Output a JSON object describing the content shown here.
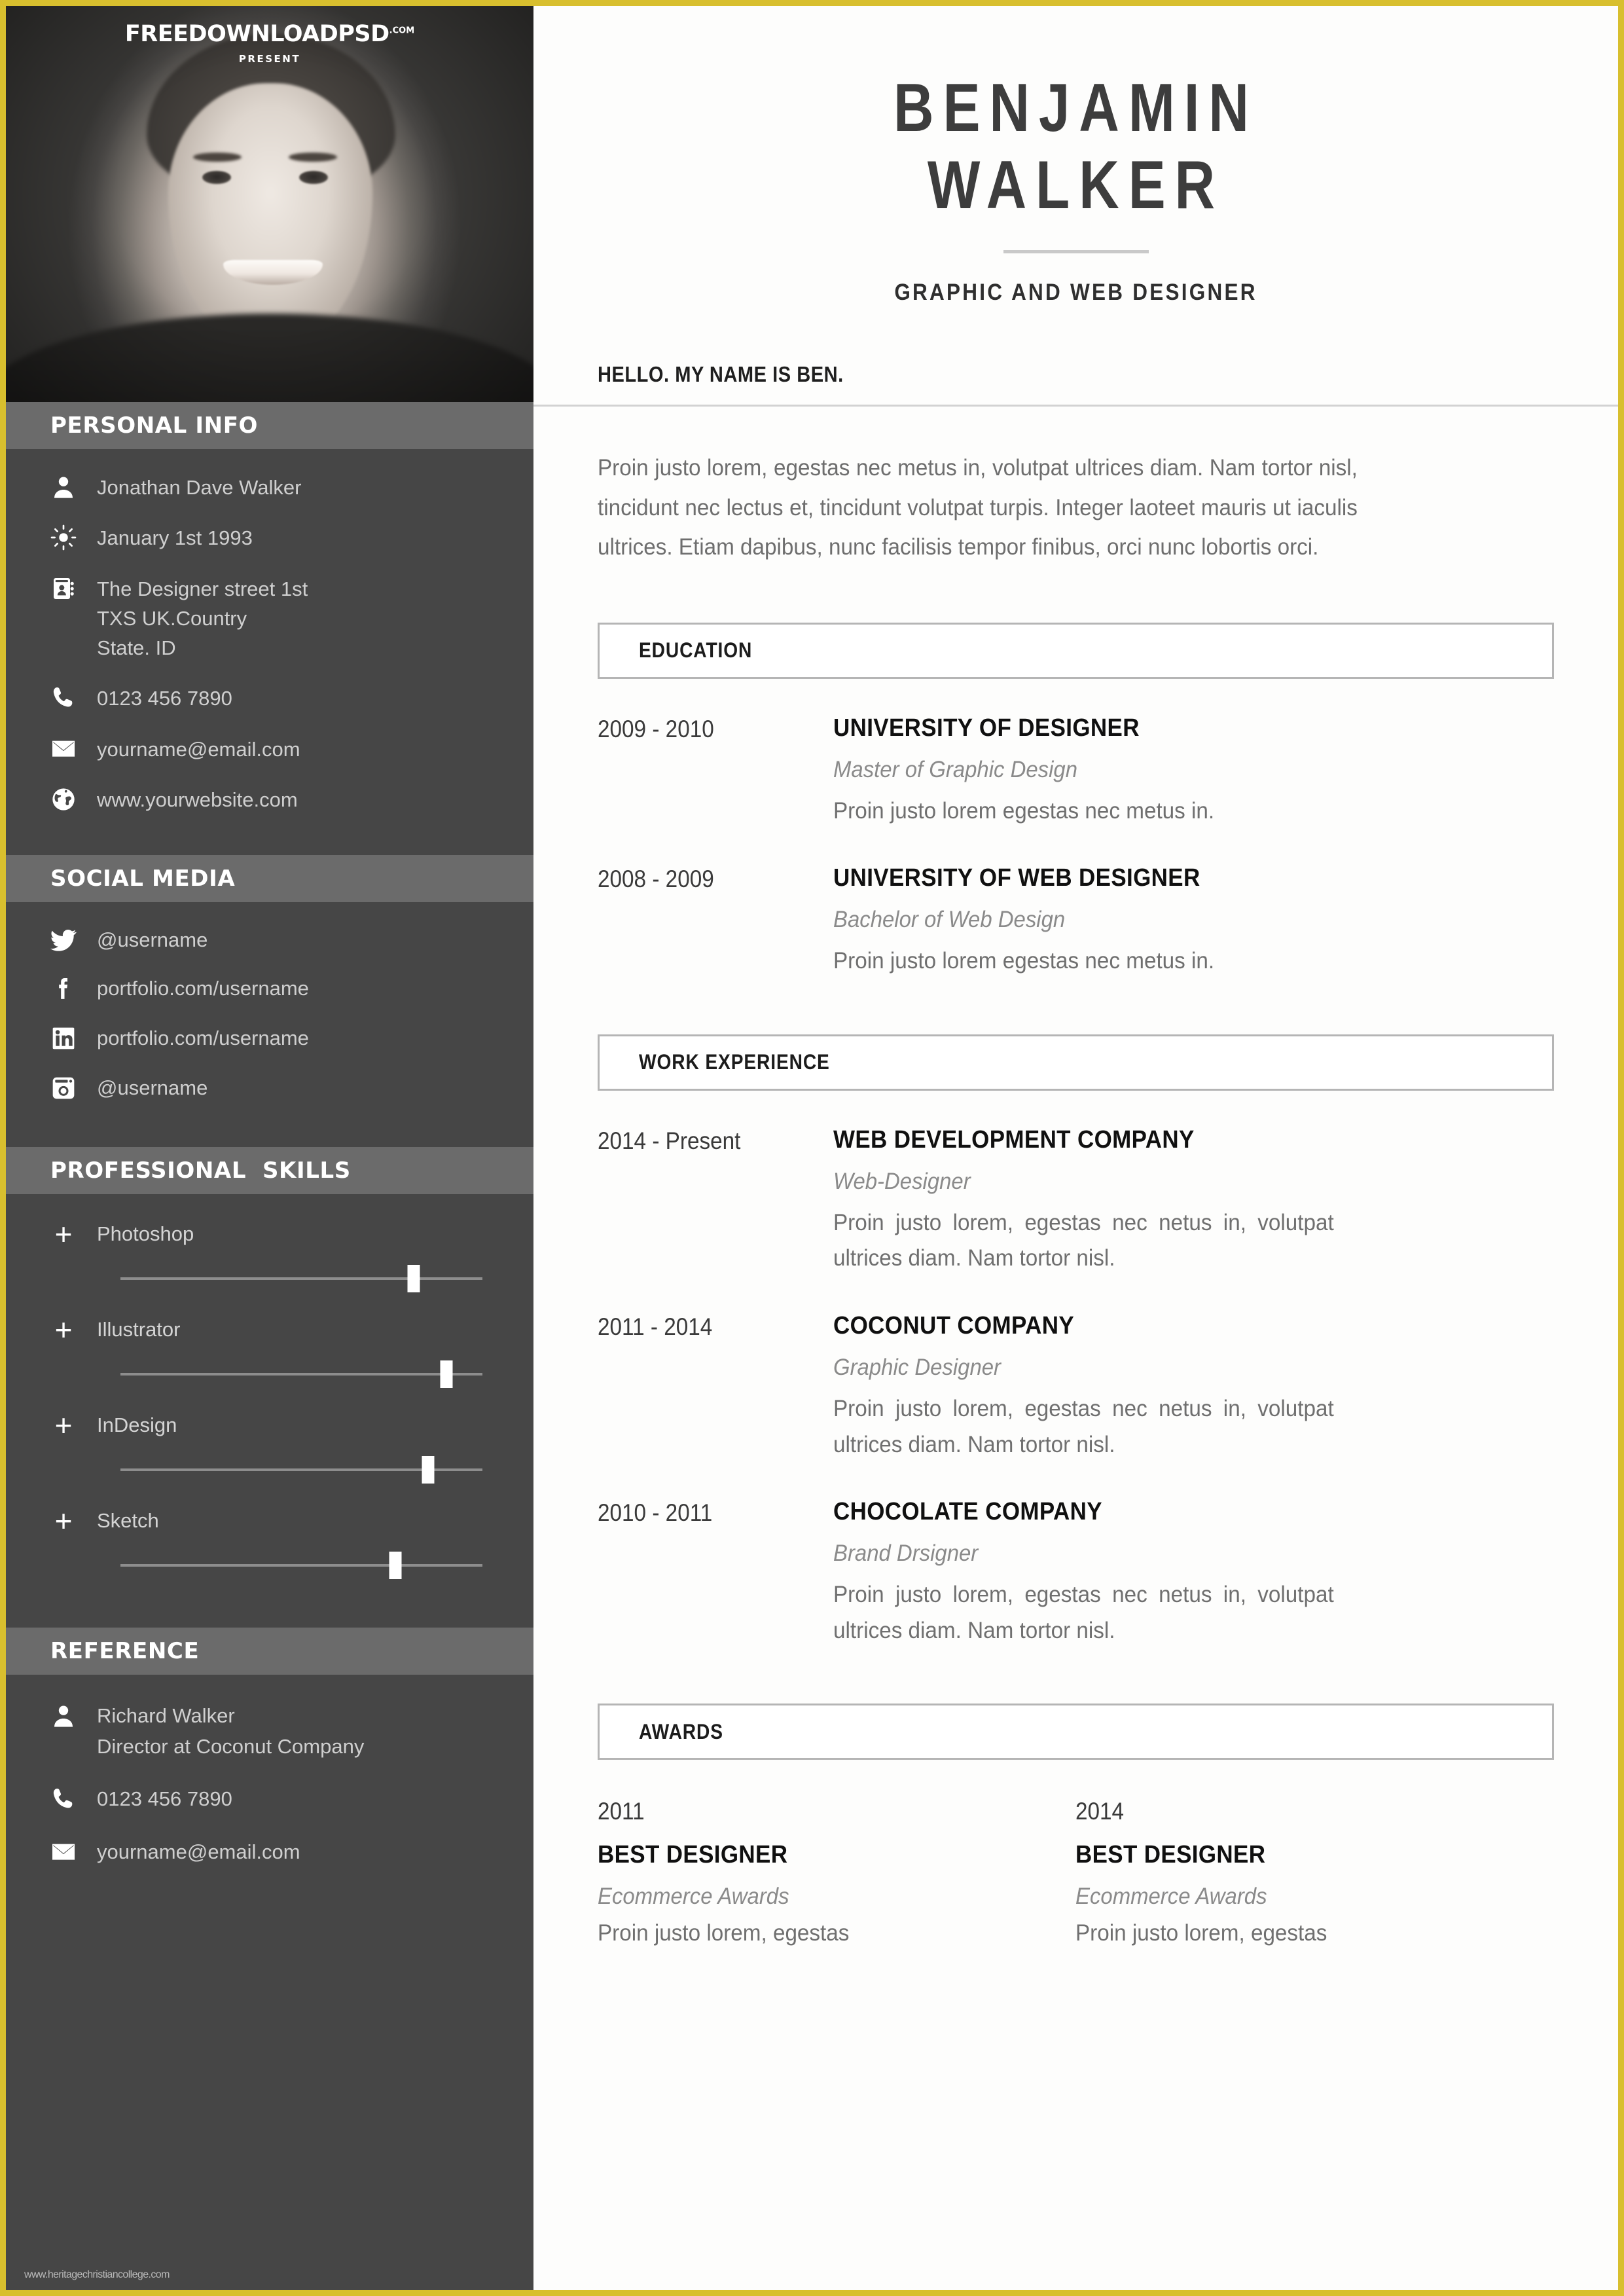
{
  "branding": {
    "logo_main": "FREEDOWNLO",
    "logo_mid": "A",
    "logo_end": "DPSD",
    "logo_suffix": ".COM",
    "present_label": "PRESENT"
  },
  "header": {
    "first_name": "BENJAMIN",
    "last_name": "WALKER",
    "job_title": "GRAPHIC AND WEB DESIGNER"
  },
  "about": {
    "greeting": "HELLO. MY NAME IS BEN.",
    "paragraph": "Proin justo lorem, egestas nec metus in, volutpat ultrices diam. Nam tortor nisl, tincidunt nec lectus et, tincidunt volutpat turpis. Integer laoteet mauris ut iaculis ultrices. Etiam dapibus, nunc facilisis tempor finibus, orci nunc lobortis orci."
  },
  "sidebar": {
    "personal_info": {
      "title": "PERSONAL INFO",
      "items": [
        {
          "icon": "person-icon",
          "text": "Jonathan Dave Walker"
        },
        {
          "icon": "sun-icon",
          "text": "January 1st 1993"
        },
        {
          "icon": "address-book-icon",
          "text": "The Designer street 1st\nTXS UK.Country\nState. ID"
        },
        {
          "icon": "phone-icon",
          "text": "0123 456 7890"
        },
        {
          "icon": "envelope-icon",
          "text": "yourname@email.com"
        },
        {
          "icon": "globe-icon",
          "text": "www.yourwebsite.com"
        }
      ]
    },
    "social_media": {
      "title": "SOCIAL MEDIA",
      "items": [
        {
          "icon": "twitter-icon",
          "text": "@username"
        },
        {
          "icon": "facebook-icon",
          "text": "portfolio.com/username"
        },
        {
          "icon": "linkedin-icon",
          "text": "portfolio.com/username"
        },
        {
          "icon": "instagram-icon",
          "text": "@username"
        }
      ]
    },
    "professional_skills": {
      "title": "PROFESSIONAL  SKILLS",
      "items": [
        {
          "name": "Photoshop",
          "level": 81
        },
        {
          "name": "Illustrator",
          "level": 90
        },
        {
          "name": "InDesign",
          "level": 85
        },
        {
          "name": "Sketch",
          "level": 76
        }
      ]
    },
    "reference": {
      "title": "REFERENCE",
      "items": [
        {
          "icon": "person-icon",
          "text": "Richard Walker\nDirector at Coconut Company"
        },
        {
          "icon": "phone-icon",
          "text": "0123 456 7890"
        },
        {
          "icon": "envelope-icon",
          "text": "yourname@email.com"
        }
      ]
    },
    "watermark": "www.heritagechristiancollege.com"
  },
  "education": {
    "title": "EDUCATION",
    "entries": [
      {
        "period": "2009 - 2010",
        "org": "UNIVERSITY OF DESIGNER",
        "role": "Master of Graphic Design",
        "desc": "Proin justo lorem egestas nec metus in."
      },
      {
        "period": "2008 - 2009",
        "org": "UNIVERSITY OF WEB DESIGNER",
        "role": "Bachelor of Web Design",
        "desc": "Proin justo lorem egestas nec metus in."
      }
    ]
  },
  "work_experience": {
    "title": "WORK EXPERIENCE",
    "entries": [
      {
        "period": "2014 - Present",
        "org": "WEB DEVELOPMENT COMPANY",
        "role": "Web-Designer",
        "desc": "Proin justo lorem, egestas nec netus in, volutpat ultrices diam. Nam tortor nisl."
      },
      {
        "period": "2011 - 2014",
        "org": "COCONUT COMPANY",
        "role": "Graphic Designer",
        "desc": "Proin justo lorem, egestas nec netus in, volutpat ultrices diam. Nam tortor nisl."
      },
      {
        "period": "2010 - 2011",
        "org": "CHOCOLATE  COMPANY",
        "role": "Brand Drsigner",
        "desc": "Proin justo lorem, egestas nec netus in, volutpat ultrices diam. Nam tortor nisl."
      }
    ]
  },
  "awards": {
    "title": "AWARDS",
    "entries": [
      {
        "year": "2011",
        "name": "BEST  DESIGNER",
        "sub": "Ecommerce Awards",
        "desc": "Proin justo  lorem, egestas"
      },
      {
        "year": "2014",
        "name": "BEST  DESIGNER",
        "sub": "Ecommerce Awards",
        "desc": "Proin justo  lorem, egestas"
      }
    ]
  },
  "colors": {
    "frame": "#d8bf2e",
    "sidebar_bg": "#464646",
    "section_bar": "#6b6b6b",
    "text_light": "#cfcfcf",
    "main_bg": "#fdfdfc"
  }
}
